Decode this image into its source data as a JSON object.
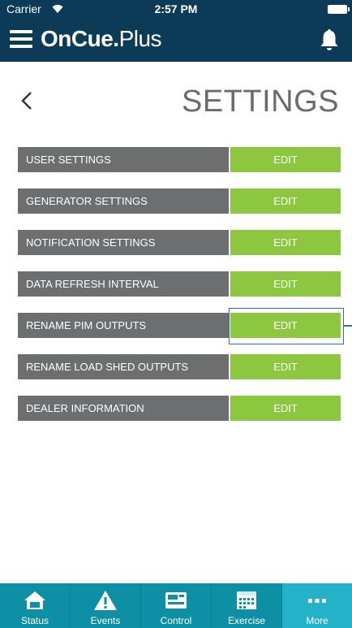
{
  "status_bar": {
    "carrier": "Carrier",
    "time": "2:57 PM"
  },
  "header": {
    "logo_bold": "OnCue",
    "logo_dot": ".",
    "logo_light": "Plus"
  },
  "page": {
    "title": "SETTINGS"
  },
  "settings": [
    {
      "label": "USER SETTINGS",
      "action": "EDIT"
    },
    {
      "label": "GENERATOR SETTINGS",
      "action": "EDIT"
    },
    {
      "label": "NOTIFICATION SETTINGS",
      "action": "EDIT"
    },
    {
      "label": "DATA REFRESH INTERVAL",
      "action": "EDIT"
    },
    {
      "label": "RENAME PIM OUTPUTS",
      "action": "EDIT"
    },
    {
      "label": "RENAME LOAD SHED OUTPUTS",
      "action": "EDIT"
    },
    {
      "label": "DEALER INFORMATION",
      "action": "EDIT"
    }
  ],
  "tabs": [
    {
      "label": "Status",
      "icon": "home-icon"
    },
    {
      "label": "Events",
      "icon": "warning-icon"
    },
    {
      "label": "Control",
      "icon": "controller-icon"
    },
    {
      "label": "Exercise",
      "icon": "calendar-icon"
    },
    {
      "label": "More",
      "icon": "more-icon",
      "active": true
    }
  ],
  "colors": {
    "header_bg": "#0b3b56",
    "label_bg": "#6d6e70",
    "edit_bg": "#8dc63f",
    "tabbar_bg": "#0d8fa6",
    "tab_active_bg": "#23b2c8",
    "highlight": "#2f6fb3"
  }
}
